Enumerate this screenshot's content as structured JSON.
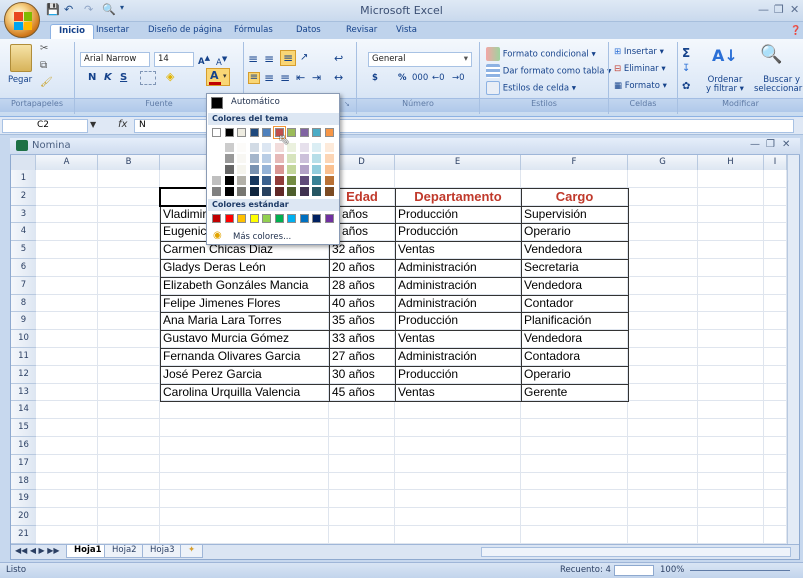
{
  "app": {
    "title": "Microsoft Excel"
  },
  "tabs": [
    "Inicio",
    "Insertar",
    "Diseño de página",
    "Fórmulas",
    "Datos",
    "Revisar",
    "Vista"
  ],
  "ribbon": {
    "clipboard": {
      "paste": "Pegar",
      "label": "Portapapeles"
    },
    "font": {
      "family": "Arial Narrow",
      "size": "14",
      "bold": "N",
      "italic": "K",
      "underline": "S",
      "label": "Fuente"
    },
    "alignment": {
      "label": "Alineación"
    },
    "number": {
      "format": "General",
      "currency": "$",
      "percent": "%",
      "thousands": "000",
      "label": "Número"
    },
    "styles": {
      "conditional": "Formato condicional",
      "table": "Dar formato como tabla",
      "cell": "Estilos de celda",
      "label": "Estilos"
    },
    "cells": {
      "insert": "Insertar",
      "delete": "Eliminar",
      "format": "Formato",
      "label": "Celdas"
    },
    "editing": {
      "sort": "Ordenar",
      "sort2": "y filtrar",
      "find": "Buscar y",
      "find2": "seleccionar",
      "label": "Modificar"
    }
  },
  "formula_bar": {
    "cell": "C2",
    "fx": "fx",
    "value": "N"
  },
  "workbook": {
    "title": "Nomina"
  },
  "columns": [
    "A",
    "B",
    "C",
    "D",
    "E",
    "F",
    "G",
    "H",
    "I"
  ],
  "rows": [
    "1",
    "2",
    "3",
    "4",
    "5",
    "6",
    "7",
    "8",
    "9",
    "10",
    "11",
    "12",
    "13",
    "14",
    "15",
    "16",
    "17",
    "18",
    "19",
    "20",
    "21"
  ],
  "table": {
    "headers": [
      "Nom",
      "Edad",
      "Departamento",
      "Cargo"
    ],
    "rows": [
      [
        "Vladimir",
        "5 años",
        "Producción",
        "Supervisión"
      ],
      [
        "Eugenic",
        "9 años",
        "Producción",
        "Operario"
      ],
      [
        "Carmen Chicas Diaz",
        "32 años",
        "Ventas",
        "Vendedora"
      ],
      [
        "Gladys Deras León",
        "20 años",
        "Administración",
        "Secretaria"
      ],
      [
        "Elizabeth Gonzáles Mancia",
        "28 años",
        "Administración",
        "Vendedora"
      ],
      [
        "Felipe Jimenes Flores",
        "40 años",
        "Administración",
        "Contador"
      ],
      [
        "Ana Maria Lara Torres",
        "35 años",
        "Producción",
        "Planificación"
      ],
      [
        "Gustavo Murcia Gómez",
        "33 años",
        "Ventas",
        "Vendedora"
      ],
      [
        "Fernanda Olivares Garcia",
        "27 años",
        "Administración",
        "Contadora"
      ],
      [
        "José Perez Garcia",
        "30 años",
        "Producción",
        "Operario"
      ],
      [
        "Carolina Urquilla Valencia",
        "45 años",
        "Ventas",
        "Gerente"
      ]
    ]
  },
  "color_popup": {
    "automatic": "Automático",
    "theme_colors": "Colores del tema",
    "standard_colors": "Colores estándar",
    "more_colors": "Más colores...",
    "theme": [
      "#ffffff",
      "#000000",
      "#eeece1",
      "#1f497d",
      "#4f81bd",
      "#c0504d",
      "#9bbb59",
      "#8064a2",
      "#4bacc6",
      "#f79646"
    ],
    "standard": [
      "#c00000",
      "#ff0000",
      "#ffc000",
      "#ffff00",
      "#92d050",
      "#00b050",
      "#00b0f0",
      "#0070c0",
      "#002060",
      "#7030a0"
    ]
  },
  "sheets": [
    "Hoja1",
    "Hoja2",
    "Hoja3"
  ],
  "status": {
    "ready": "Listo",
    "count": "Recuento: 4",
    "zoom": "100%"
  }
}
